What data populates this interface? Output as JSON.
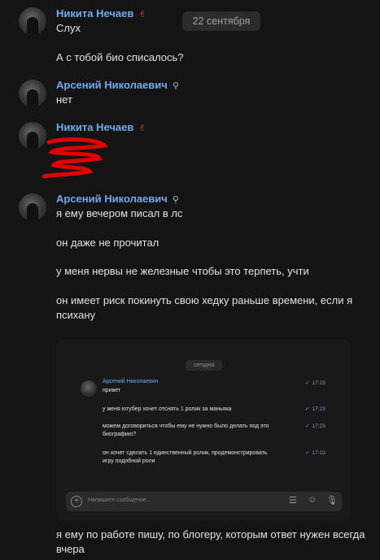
{
  "date_separator": "22 сентября",
  "groups": [
    {
      "author": "Никита Нечаев",
      "badge": "✌",
      "messages": [
        "Слух",
        "А с тобой био списалось?"
      ]
    },
    {
      "author": "Арсений Николаевич",
      "badge": "⚲",
      "messages": [
        "нет"
      ]
    },
    {
      "author": "Никита Нечаев",
      "badge": "✌",
      "messages": []
    },
    {
      "author": "Арсений Николаевич",
      "badge": "⚲",
      "messages": [
        "я ему вечером писал в лс",
        "он даже не прочитал",
        "у меня нервы не железные чтобы это терпеть, учти",
        "он имеет риск покинуть свою хедку раньше времени, если я",
        "психану"
      ]
    }
  ],
  "screenshot": {
    "today_label": "сегодня",
    "author": "Арсений Николаевич",
    "messages": [
      {
        "text": "привет",
        "time": "17:23"
      },
      {
        "text": "у меня ютубер хочет отснять 1 ролик за маньяка",
        "time": "17:23"
      },
      {
        "text": "можем договориться чтобы ему не нужно было делать под это",
        "text2": "биографию?",
        "time": "17:23"
      },
      {
        "text": "он хочет сделать 1 единственный ролик, продемонстрировать",
        "text2": "игру подобной роли",
        "time": "17:23"
      }
    ],
    "composer_placeholder": "Напишите сообщение..."
  },
  "after_screenshot": [
    "я ему по работе пишу, по блогеру, которым ответ нужен всегда",
    "вчера"
  ],
  "colors": {
    "name": "#71aaeb",
    "background": "#141414",
    "redaction": "#e00000"
  }
}
